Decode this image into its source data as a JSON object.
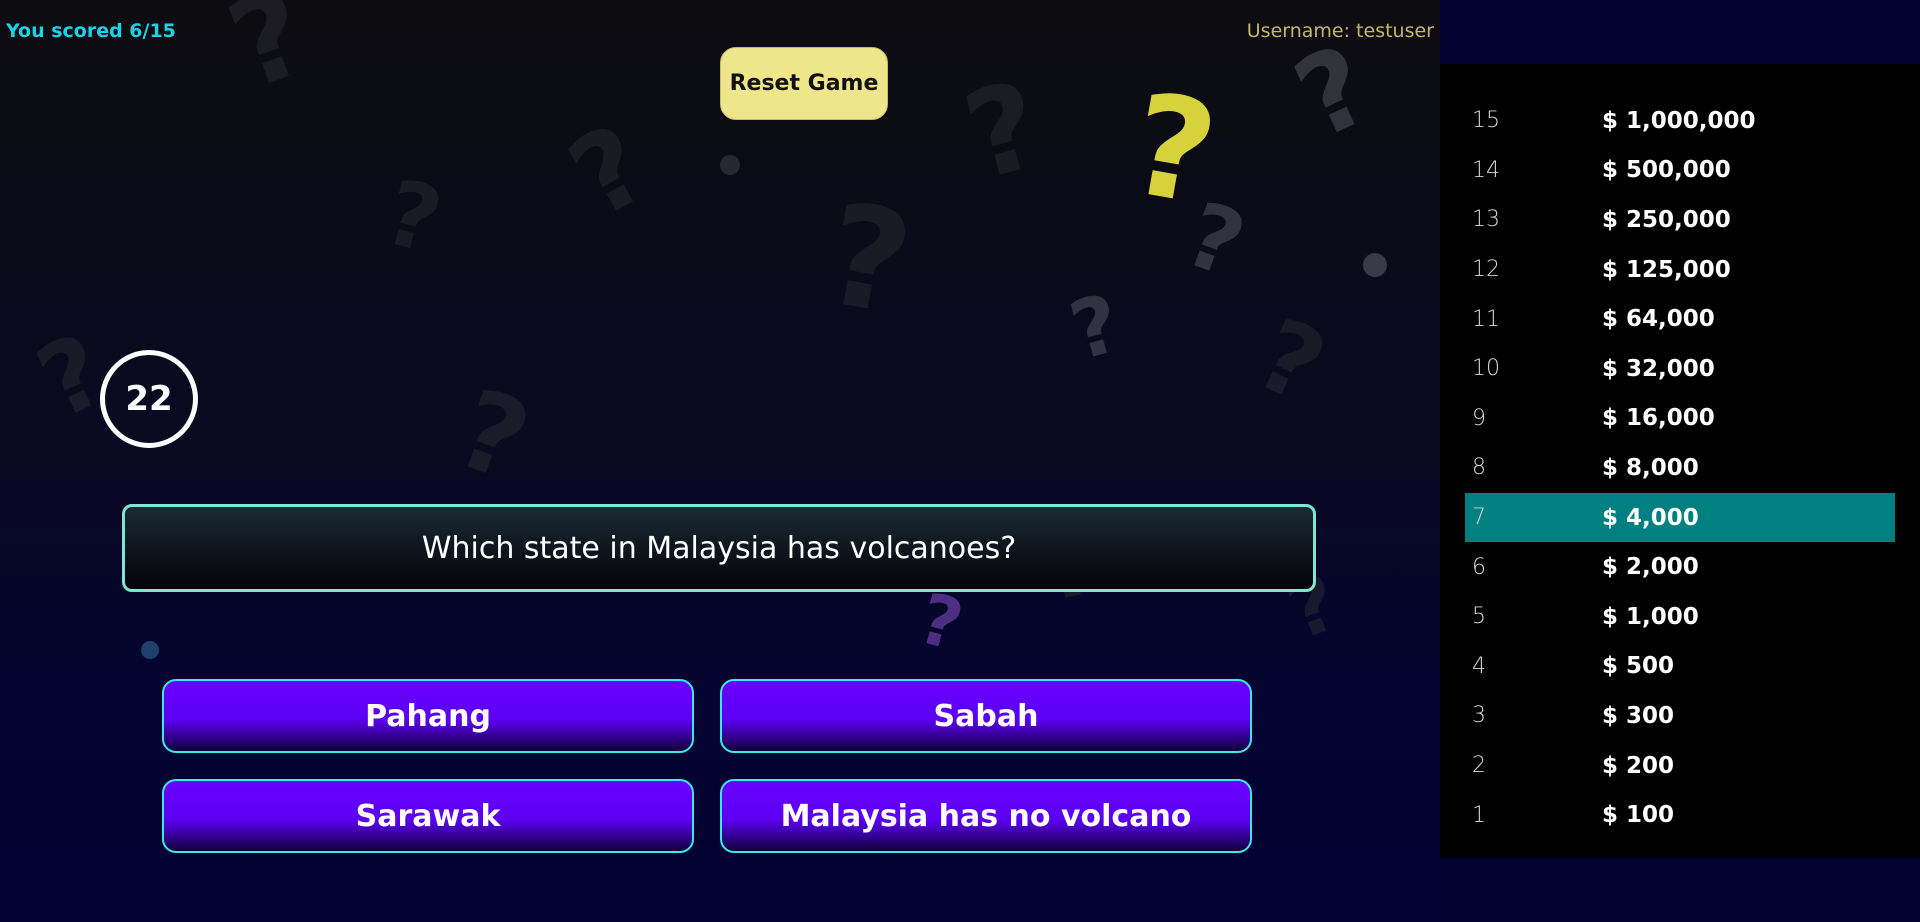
{
  "header": {
    "score_text": "You scored 6/15",
    "username_text": "Username: testuser",
    "reset_label": "Reset Game"
  },
  "timer": {
    "value": "22"
  },
  "question": {
    "text": "Which state in Malaysia has volcanoes?"
  },
  "answers": [
    {
      "label": "Pahang"
    },
    {
      "label": "Sabah"
    },
    {
      "label": "Sarawak"
    },
    {
      "label": "Malaysia has no volcano"
    }
  ],
  "money_pyramid": {
    "active_level": 7,
    "active_color": "#008080",
    "items": [
      {
        "num": "15",
        "amount": "$ 1,000,000"
      },
      {
        "num": "14",
        "amount": "$ 500,000"
      },
      {
        "num": "13",
        "amount": "$ 250,000"
      },
      {
        "num": "12",
        "amount": "$ 125,000"
      },
      {
        "num": "11",
        "amount": "$ 64,000"
      },
      {
        "num": "10",
        "amount": "$ 32,000"
      },
      {
        "num": "9",
        "amount": "$ 16,000"
      },
      {
        "num": "8",
        "amount": "$ 8,000"
      },
      {
        "num": "7",
        "amount": "$ 4,000"
      },
      {
        "num": "6",
        "amount": "$ 2,000"
      },
      {
        "num": "5",
        "amount": "$ 1,000"
      },
      {
        "num": "4",
        "amount": "$ 500"
      },
      {
        "num": "3",
        "amount": "$ 300"
      },
      {
        "num": "2",
        "amount": "$ 200"
      },
      {
        "num": "1",
        "amount": "$ 100"
      }
    ]
  },
  "colors": {
    "score": "#19d3e6",
    "username": "#c8b46a",
    "reset_button": "#efe58a",
    "question_border": "#7ee6d0",
    "answer_fill": "#6a00ff",
    "answer_border": "#3fe6ee"
  }
}
